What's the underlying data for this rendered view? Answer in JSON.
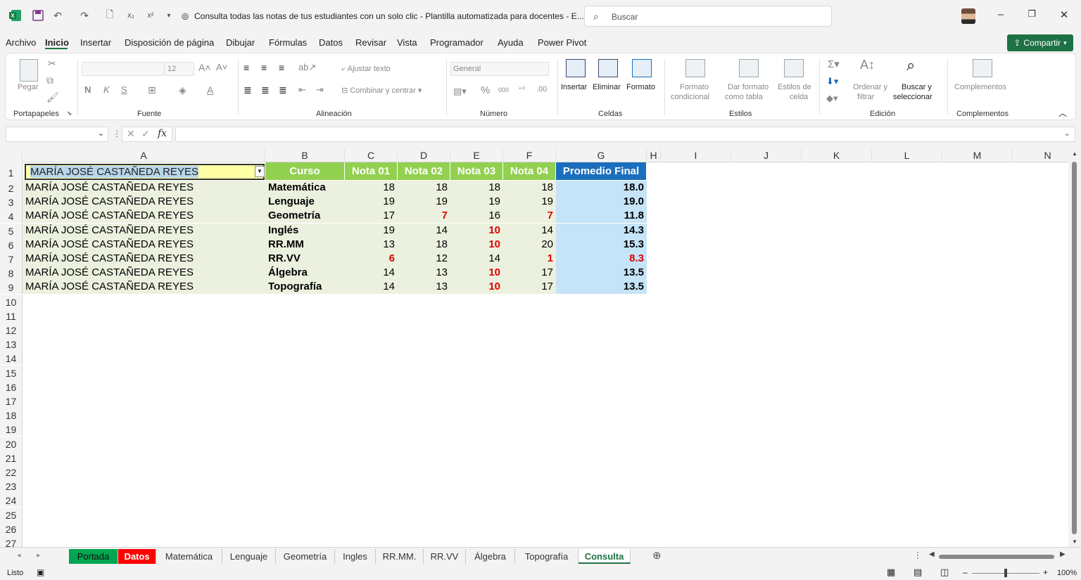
{
  "titlebar": {
    "doc_title": "Consulta todas las notas de tus estudiantes con un solo clic - Plantilla automatizada para docentes - E...",
    "search_placeholder": "Buscar"
  },
  "menu": {
    "items": [
      "Archivo",
      "Inicio",
      "Insertar",
      "Disposición de página",
      "Dibujar",
      "Fórmulas",
      "Datos",
      "Revisar",
      "Vista",
      "Programador",
      "Ayuda",
      "Power Pivot"
    ],
    "active": "Inicio",
    "share_label": "Compartir"
  },
  "ribbon": {
    "portapapeles": {
      "pegar": "Pegar",
      "label": "Portapapeles"
    },
    "fuente": {
      "size": "12",
      "bold": "N",
      "italic": "K",
      "underline": "S",
      "label": "Fuente"
    },
    "alineacion": {
      "wrap": "Ajustar texto",
      "merge": "Combinar y centrar",
      "label": "Alineación"
    },
    "numero": {
      "format": "General",
      "label": "Número"
    },
    "celdas": {
      "insertar": "Insertar",
      "eliminar": "Eliminar",
      "formato": "Formato",
      "label": "Celdas"
    },
    "estilos": {
      "cond1": "Formato",
      "cond2": "condicional",
      "tabla1": "Dar formato",
      "tabla2": "como tabla",
      "celda1": "Estilos de",
      "celda2": "celda",
      "label": "Estilos"
    },
    "edicion": {
      "ordenar1": "Ordenar y",
      "ordenar2": "filtrar",
      "buscar1": "Buscar y",
      "buscar2": "seleccionar",
      "label": "Edición"
    },
    "complementos": {
      "btn": "Complementos",
      "label": "Complementos"
    }
  },
  "formula_bar": {
    "name_box": "",
    "fx": "fx",
    "content": ""
  },
  "columns": [
    "A",
    "B",
    "C",
    "D",
    "E",
    "F",
    "G",
    "H",
    "I",
    "J",
    "K",
    "L",
    "M",
    "N"
  ],
  "rows": [
    "1",
    "2",
    "3",
    "4",
    "5",
    "6",
    "7",
    "8",
    "9",
    "10",
    "11",
    "12",
    "13",
    "14",
    "15",
    "16",
    "17",
    "18",
    "19",
    "20",
    "21",
    "22",
    "23",
    "24",
    "25",
    "26",
    "27"
  ],
  "table": {
    "selected_name": "MARÍA JOSÉ CASTAÑEDA REYES",
    "headers": [
      "Curso",
      "Nota 01",
      "Nota 02",
      "Nota 03",
      "Nota 04",
      "Promedio Final"
    ],
    "rows": [
      {
        "name": "MARÍA JOSÉ CASTAÑEDA REYES",
        "curso": "Matemática",
        "n1": "18",
        "n2": "18",
        "n3": "18",
        "n4": "18",
        "avg": "18.0",
        "red": [
          false,
          false,
          false,
          false,
          false
        ]
      },
      {
        "name": "MARÍA JOSÉ CASTAÑEDA REYES",
        "curso": "Lenguaje",
        "n1": "19",
        "n2": "19",
        "n3": "19",
        "n4": "19",
        "avg": "19.0",
        "red": [
          false,
          false,
          false,
          false,
          false
        ]
      },
      {
        "name": "MARÍA JOSÉ CASTAÑEDA REYES",
        "curso": "Geometría",
        "n1": "17",
        "n2": "7",
        "n3": "16",
        "n4": "7",
        "avg": "11.8",
        "red": [
          false,
          true,
          false,
          true,
          false
        ]
      },
      {
        "name": "MARÍA JOSÉ CASTAÑEDA REYES",
        "curso": "Inglés",
        "n1": "19",
        "n2": "14",
        "n3": "10",
        "n4": "14",
        "avg": "14.3",
        "red": [
          false,
          false,
          true,
          false,
          false
        ]
      },
      {
        "name": "MARÍA JOSÉ CASTAÑEDA REYES",
        "curso": "RR.MM",
        "n1": "13",
        "n2": "18",
        "n3": "10",
        "n4": "20",
        "avg": "15.3",
        "red": [
          false,
          false,
          true,
          false,
          false
        ]
      },
      {
        "name": "MARÍA JOSÉ CASTAÑEDA REYES",
        "curso": "RR.VV",
        "n1": "6",
        "n2": "12",
        "n3": "14",
        "n4": "1",
        "avg": "8.3",
        "red": [
          true,
          false,
          false,
          true,
          true
        ]
      },
      {
        "name": "MARÍA JOSÉ CASTAÑEDA REYES",
        "curso": "Álgebra",
        "n1": "14",
        "n2": "13",
        "n3": "10",
        "n4": "17",
        "avg": "13.5",
        "red": [
          false,
          false,
          true,
          false,
          false
        ]
      },
      {
        "name": "MARÍA JOSÉ CASTAÑEDA REYES",
        "curso": "Topografía",
        "n1": "14",
        "n2": "13",
        "n3": "10",
        "n4": "17",
        "avg": "13.5",
        "red": [
          false,
          false,
          true,
          false,
          false
        ]
      }
    ]
  },
  "sheets": [
    "Portada",
    "Datos",
    "Matemática",
    "Lenguaje",
    "Geometría",
    "Ingles",
    "RR.MM.",
    "RR.VV",
    "Álgebra",
    "Topografía",
    "Consulta"
  ],
  "active_sheet": "Consulta",
  "status": {
    "ready": "Listo",
    "zoom": "100%"
  },
  "colors": {
    "accent": "#217346",
    "header_green": "#92d050",
    "header_blue": "#1a6ebd",
    "fail_red": "#e00000"
  }
}
